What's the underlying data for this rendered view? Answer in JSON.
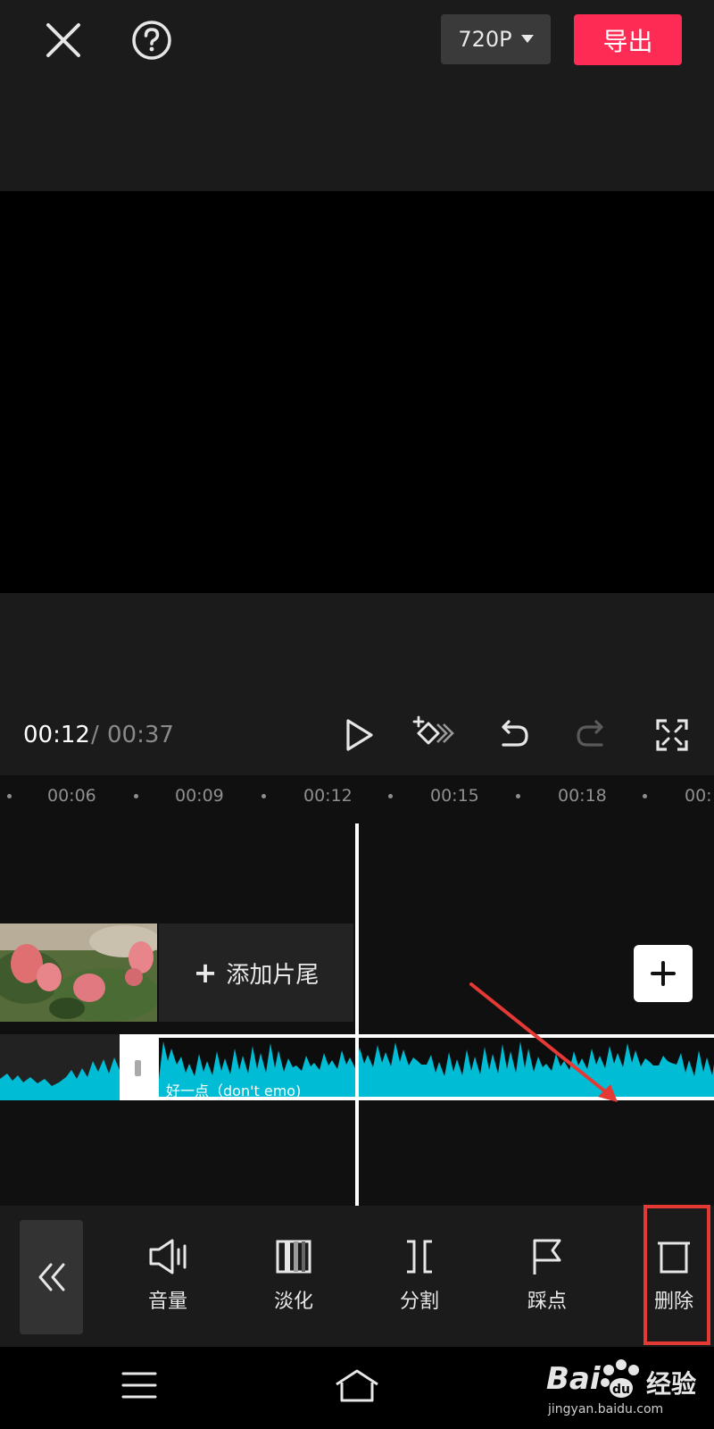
{
  "topbar": {
    "close_icon": "close-icon",
    "help_icon": "help-icon",
    "resolution": "720P",
    "export_label": "导出"
  },
  "controls": {
    "current_time": "00:12",
    "separator": "/",
    "total_time": "00:37"
  },
  "timeline": {
    "ruler_labels": [
      "00:06",
      "00:09",
      "00:12",
      "00:15",
      "00:18",
      "00:"
    ],
    "add_ending_label": "添加片尾",
    "audio_title": "好一点（don't emo)"
  },
  "toolbar": {
    "items": [
      {
        "label": "音量",
        "icon": "volume-icon"
      },
      {
        "label": "淡化",
        "icon": "fade-icon"
      },
      {
        "label": "分割",
        "icon": "split-icon"
      },
      {
        "label": "踩点",
        "icon": "beat-flag-icon"
      },
      {
        "label": "删除",
        "icon": "delete-icon"
      }
    ]
  },
  "watermark": {
    "brand": "Bai",
    "brand2": "经验",
    "url": "jingyan.baidu.com"
  },
  "colors": {
    "accent": "#fe2c55",
    "waveform": "#00bcd4",
    "highlight": "#e53935"
  }
}
